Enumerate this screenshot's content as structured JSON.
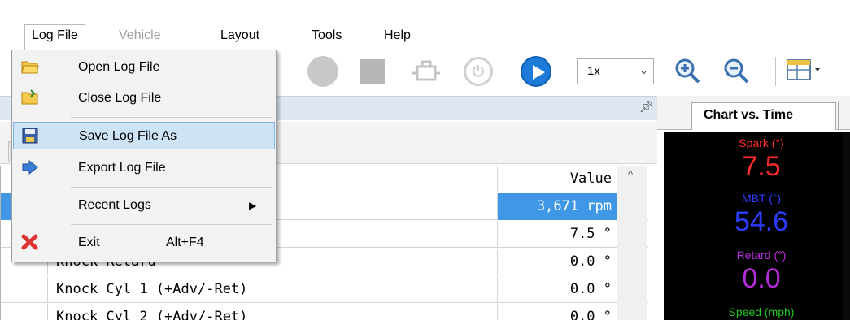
{
  "menubar": {
    "items": [
      {
        "label": "Log File",
        "state": "active"
      },
      {
        "label": "Vehicle",
        "state": "disabled"
      },
      {
        "label": "Layout",
        "state": "normal"
      },
      {
        "label": "Tools",
        "state": "normal"
      },
      {
        "label": "Help",
        "state": "normal"
      }
    ]
  },
  "log_menu": {
    "items": [
      {
        "label": "Open Log File",
        "icon": "folder-open-icon"
      },
      {
        "label": "Close Log File",
        "icon": "folder-close-icon"
      },
      {
        "label": "Save Log File As",
        "icon": "save-icon"
      },
      {
        "label": "Export Log File",
        "icon": "export-icon"
      },
      {
        "label": "Recent Logs",
        "icon": "",
        "submenu": true
      },
      {
        "label": "Exit",
        "shortcut": "Alt+F4",
        "icon": "close-x-icon"
      }
    ]
  },
  "toolbar": {
    "speed_value": "1x",
    "play_color": "#1e7ad8"
  },
  "grid": {
    "value_header": "Value",
    "rows": [
      {
        "name": "",
        "value": "3,671 rpm",
        "selected": true
      },
      {
        "name": "",
        "value": "7.5 °"
      },
      {
        "name": "Knock Retard",
        "value": "0.0 °"
      },
      {
        "name": "Knock Cyl 1 (+Adv/-Ret)",
        "value": "0.0 °"
      },
      {
        "name": "Knock Cyl 2 (+Adv/-Ret)",
        "value": "0.0 °"
      }
    ]
  },
  "chart_tab": {
    "label": "Chart vs. Time"
  },
  "gauges": [
    {
      "label": "Spark (°)",
      "value": "7.5",
      "color": "#ff2a2a"
    },
    {
      "label": "MBT (°)",
      "value": "54.6",
      "color": "#2b3cff"
    },
    {
      "label": "Retard (°)",
      "value": "0.0",
      "color": "#b52bd9"
    },
    {
      "label": "Speed (mph)",
      "value": "",
      "color": "#22c322"
    }
  ]
}
